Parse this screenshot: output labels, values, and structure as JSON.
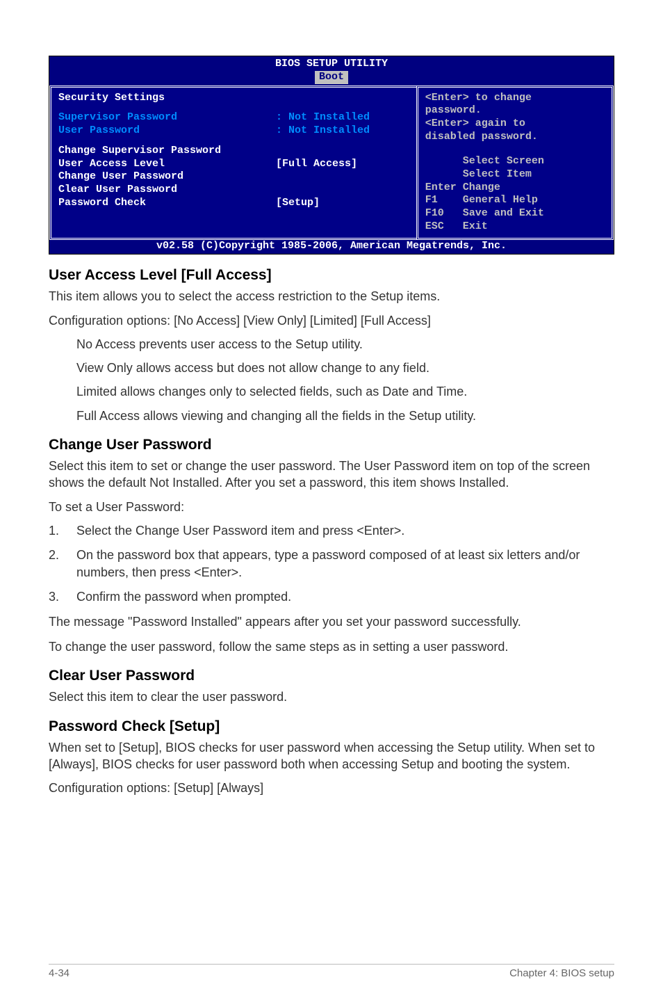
{
  "bios": {
    "title": "BIOS SETUP UTILITY",
    "tab": "Boot",
    "left": {
      "heading": "Security Settings",
      "sup_label": "Supervisor Password",
      "sup_val": ": Not Installed",
      "user_label": "User Password",
      "user_val": ": Not Installed",
      "chg_sup": "Change Supervisor Password",
      "ual_label": "User Access Level",
      "ual_val": "[Full Access]",
      "chg_user": "Change User Password",
      "clr_user": "Clear User Password",
      "pwc_label": "Password Check",
      "pwc_val": "[Setup]"
    },
    "right": {
      "help1": "<Enter> to change",
      "help2": "password.",
      "help3": "<Enter> again to",
      "help4": "disabled password.",
      "k1": "      Select Screen",
      "k2": "      Select Item",
      "k3": "Enter Change",
      "k4": "F1    General Help",
      "k5": "F10   Save and Exit",
      "k6": "ESC   Exit"
    },
    "footer": "v02.58 (C)Copyright 1985-2006, American Megatrends, Inc."
  },
  "sections": {
    "ual_h": "User Access Level [Full Access]",
    "ual_p1": "This item allows you to select the access restriction to the Setup items.",
    "ual_p2": "Configuration options: [No Access] [View Only] [Limited] [Full Access]",
    "ual_na": "No Access prevents user access to the Setup utility.",
    "ual_vo": "View Only allows access but does not allow change to any field.",
    "ual_li": "Limited allows changes only to selected fields, such as Date and Time.",
    "ual_fa": "Full Access allows viewing and changing all the fields in the Setup utility.",
    "cup_h": "Change User Password",
    "cup_p1": "Select this item to set or change the user password. The User Password item on top of the screen shows the default Not Installed. After you set a password, this item shows Installed.",
    "cup_p2": "To set a User Password:",
    "step1": "Select the Change User Password item and press <Enter>.",
    "step2": "On the password box that appears, type a password composed of at least six letters and/or numbers, then press <Enter>.",
    "step3": "Confirm the password when prompted.",
    "cup_p3": "The message \"Password Installed\" appears after you set your password successfully.",
    "cup_p4": "To change the user password, follow the same steps as in setting a user password.",
    "clr_h": "Clear User Password",
    "clr_p1": "Select this item to clear the user password.",
    "pwc_h": "Password Check [Setup]",
    "pwc_p1": "When set to [Setup], BIOS checks for user password when accessing the Setup utility. When set to [Always], BIOS checks for user password both when accessing Setup and booting the system.",
    "pwc_p2": "Configuration options: [Setup] [Always]"
  },
  "footer": {
    "left": "4-34",
    "right": "Chapter 4: BIOS setup"
  }
}
